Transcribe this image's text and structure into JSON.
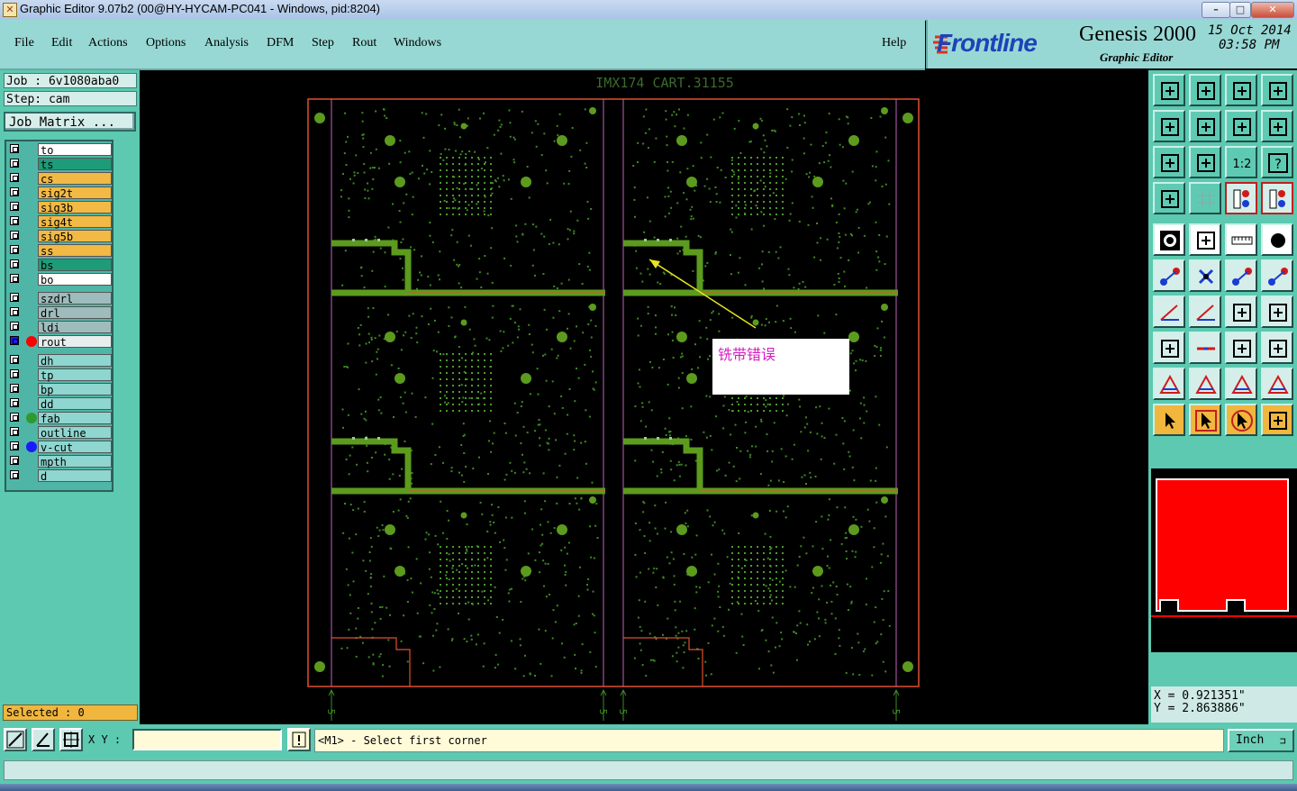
{
  "window": {
    "title": "Graphic Editor 9.07b2 (00@HY-HYCAM-PC041 - Windows, pid:8204)"
  },
  "menu": {
    "items": [
      "File",
      "Edit",
      "Actions",
      "Options",
      "Analysis",
      "DFM",
      "Step",
      "Rout",
      "Windows"
    ],
    "help": "Help"
  },
  "brand": {
    "logo": "Frontline",
    "product": "Genesis 2000",
    "subtitle": "Graphic Editor",
    "date": "15 Oct 2014",
    "time": "03:58 PM"
  },
  "job": {
    "job_line": "Job  : 6v1080aba0",
    "step_line": "Step: cam",
    "matrix_button": "Job Matrix ..."
  },
  "layers": [
    {
      "name": "to",
      "bg": "#ffffff",
      "dot": ""
    },
    {
      "name": "ts",
      "bg": "#1e9b78",
      "dot": ""
    },
    {
      "name": "cs",
      "bg": "#f2b945",
      "dot": ""
    },
    {
      "name": "sig2t",
      "bg": "#f2b945",
      "dot": ""
    },
    {
      "name": "sig3b",
      "bg": "#f2b945",
      "dot": ""
    },
    {
      "name": "sig4t",
      "bg": "#f2b945",
      "dot": ""
    },
    {
      "name": "sig5b",
      "bg": "#f2b945",
      "dot": ""
    },
    {
      "name": "ss",
      "bg": "#f2b945",
      "dot": ""
    },
    {
      "name": "bs",
      "bg": "#1e9b78",
      "dot": ""
    },
    {
      "name": "bo",
      "bg": "#ffffff",
      "dot": ""
    },
    {
      "name": "szdrl",
      "bg": "#9fbcbc",
      "dot": ""
    },
    {
      "name": "drl",
      "bg": "#9fbcbc",
      "dot": ""
    },
    {
      "name": "ldi",
      "bg": "#9fbcbc",
      "dot": ""
    },
    {
      "name": "rout",
      "bg": "#e6eeee",
      "dot": "#ff0000"
    },
    {
      "name": "dh",
      "bg": "#8fd6d0",
      "dot": ""
    },
    {
      "name": "tp",
      "bg": "#8fd6d0",
      "dot": ""
    },
    {
      "name": "bp",
      "bg": "#8fd6d0",
      "dot": ""
    },
    {
      "name": "dd",
      "bg": "#8fd6d0",
      "dot": ""
    },
    {
      "name": "fab",
      "bg": "#8fd6d0",
      "dot": "#2e9a2e"
    },
    {
      "name": "outline",
      "bg": "#8fd6d0",
      "dot": ""
    },
    {
      "name": "v-cut",
      "bg": "#8fd6d0",
      "dot": "#1a1aff"
    },
    {
      "name": "mpth",
      "bg": "#8fd6d0",
      "dot": ""
    },
    {
      "name": "d",
      "bg": "#8fd6d0",
      "dot": ""
    }
  ],
  "canvas": {
    "header": "IMX174   CART.31155",
    "annotation": "铣带错误",
    "v_labels": [
      "5",
      "5",
      "5",
      "5"
    ]
  },
  "status": {
    "selected": "Selected : 0",
    "xy_label": "X Y :",
    "xy_value": "",
    "message": "<M1> - Select first corner",
    "unit": "Inch",
    "x_coord": "X = 0.921351\"",
    "y_coord": "Y = 2.863886\""
  },
  "colors": {
    "panel": "#5cc9b0",
    "menubar": "#98d8d4",
    "board_copper": "#5c9b1e",
    "outline": "#e05030",
    "minimap_fill": "#ff0000"
  }
}
